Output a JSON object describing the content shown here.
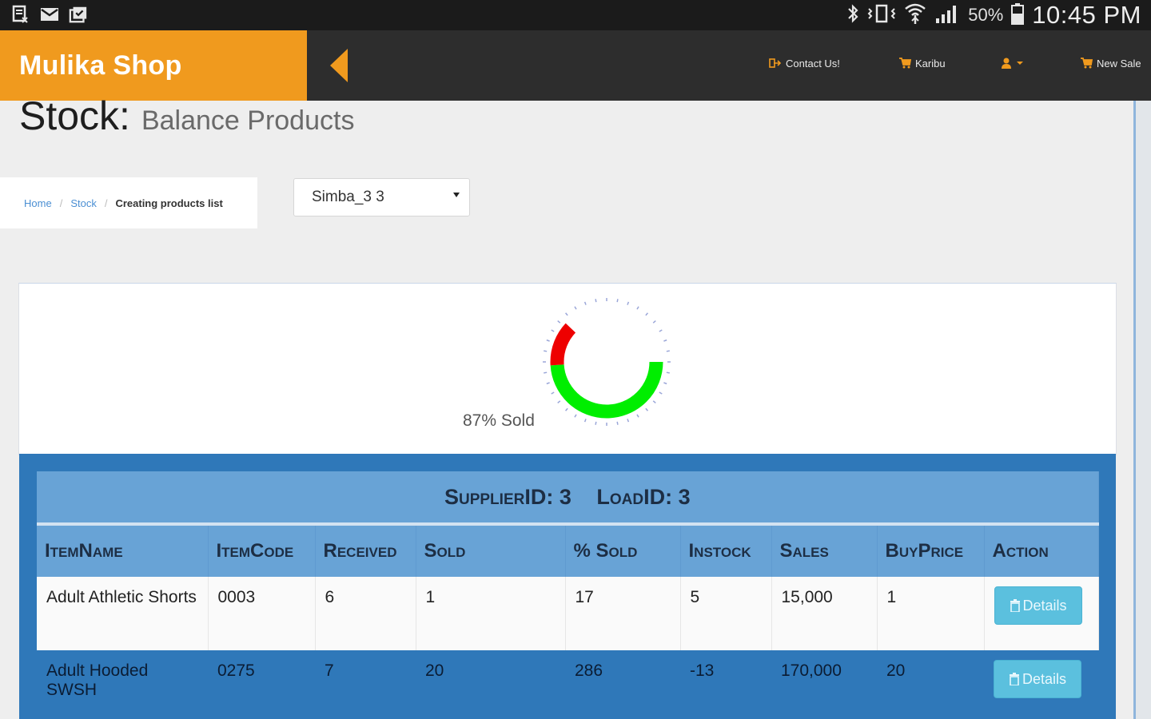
{
  "status_bar": {
    "battery_pct": "50%",
    "time": "10:45 PM",
    "left_icons": [
      "storage-icon",
      "mail-icon",
      "clipboard-icon"
    ],
    "right_icons": [
      "bluetooth-icon",
      "vibrate-icon",
      "wifi-icon",
      "signal-icon",
      "battery-icon"
    ]
  },
  "header": {
    "brand": "Mulika Shop",
    "nav": {
      "contact": "Contact Us!",
      "karibu": "Karibu",
      "new_sale": "New Sale"
    },
    "colors": {
      "brand_bg": "#f09a1e",
      "header_bg": "#2d2d2d",
      "accent": "#f09a1e"
    }
  },
  "page": {
    "title": "Stock:",
    "subtitle": "Balance Products"
  },
  "breadcrumb": {
    "home": "Home",
    "sep": "/",
    "stock": "Stock",
    "current": "Creating products list"
  },
  "select": {
    "value": "Simba_3 3"
  },
  "chart_data": {
    "type": "pie",
    "style": "donut",
    "label": "87% Sold",
    "sold_pct": 87,
    "slices": [
      {
        "value": 87,
        "color": "#00ee00"
      },
      {
        "value": 13,
        "color": "#ee0000"
      }
    ]
  },
  "table": {
    "caption": {
      "supplier": "SupplierID: 3",
      "load": "LoadID: 3"
    },
    "columns": [
      "ItemName",
      "ItemCode",
      "Received",
      "Sold",
      "% Sold",
      "Instock",
      "Sales",
      "BuyPrice",
      "Action"
    ],
    "rows": [
      {
        "name": "Adult Athletic Shorts",
        "code": "0003",
        "received": "6",
        "sold": "1",
        "pct_sold": "17",
        "instock": "5",
        "sales": "15,000",
        "buy_price": "1",
        "action": "Details"
      },
      {
        "name": "Adult Hooded SWSH",
        "code": "0275",
        "received": "7",
        "sold": "20",
        "pct_sold": "286",
        "instock": "-13",
        "sales": "170,000",
        "buy_price": "20",
        "action": "Details"
      }
    ],
    "colors": {
      "panel": "#2f78b9",
      "header": "#68a3d6",
      "button": "#5bc0de"
    }
  }
}
